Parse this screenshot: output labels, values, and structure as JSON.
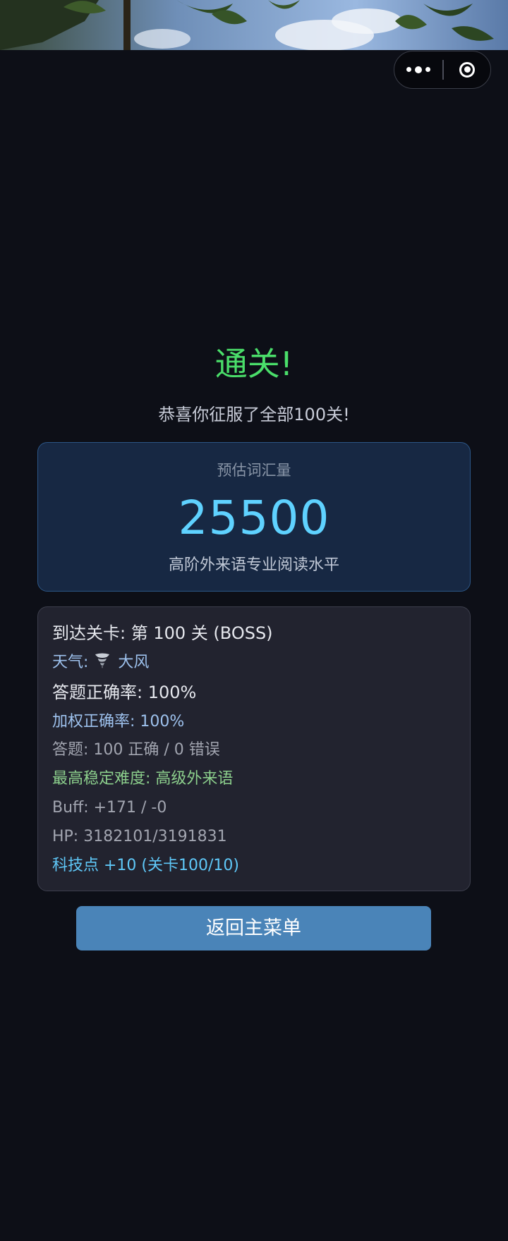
{
  "capsule": {
    "more_icon": "more-dots-icon",
    "close_icon": "target-circle-icon"
  },
  "result": {
    "title": "通关!",
    "subtitle": "恭喜你征服了全部100关!"
  },
  "vocab": {
    "label": "预估词汇量",
    "value": "25500",
    "level": "高阶外来语专业阅读水平"
  },
  "stats": {
    "level_reached": "到达关卡: 第 100 关 (BOSS)",
    "weather_prefix": "天气:",
    "weather_icon": "tornado-icon",
    "weather_value": "大风",
    "accuracy": "答题正确率: 100%",
    "weighted_accuracy": "加权正确率: 100%",
    "answers": "答题: 100 正确 / 0 错误",
    "max_difficulty": "最高稳定难度: 高级外来语",
    "buff": "Buff: +171 / -0",
    "hp": "HP: 3182101/3191831",
    "tech_points": "科技点 +10 (关卡100/10)"
  },
  "actions": {
    "back_to_menu": "返回主菜单"
  },
  "colors": {
    "background": "#0d0f17",
    "title_green": "#4ade6a",
    "vocab_blue": "#5fd2ff",
    "button": "#4a84b8"
  }
}
